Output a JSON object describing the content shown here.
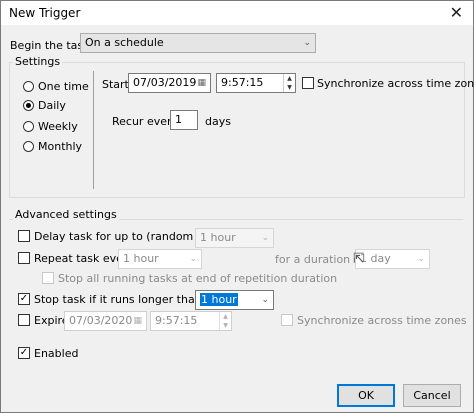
{
  "window": {
    "title": "New Trigger",
    "close_glyph": "✕"
  },
  "begin_task": {
    "label": "Begin the task:",
    "value": "On a schedule"
  },
  "settings": {
    "title": "Settings",
    "options": [
      "One time",
      "Daily",
      "Weekly",
      "Monthly"
    ],
    "selected": "Daily",
    "start_label": "Start:",
    "start_date": "07/03/2019",
    "start_time": "9:57:15",
    "sync_label": "Synchronize across time zones",
    "recur_label": "Recur every:",
    "recur_value": "1",
    "recur_unit": "days"
  },
  "advanced": {
    "title": "Advanced settings",
    "delay_label": "Delay task for up to (random delay):",
    "delay_value": "1 hour",
    "repeat_label": "Repeat task every:",
    "repeat_value": "1 hour",
    "duration_label": "for a duration of:",
    "duration_value": "1 day",
    "stop_all_label": "Stop all running tasks at end of repetition duration",
    "stop_if_label": "Stop task if it runs longer than:",
    "stop_if_value": "1 hour",
    "expire_label": "Expire:",
    "expire_date": "07/03/2020",
    "expire_time": "9:57:15",
    "expire_sync_label": "Synchronize across time zones",
    "enabled_label": "Enabled"
  },
  "buttons": {
    "ok": "OK",
    "cancel": "Cancel"
  },
  "icons": {
    "check": "✓",
    "chevron": "⌄",
    "calendar": "▦",
    "up": "▲",
    "down": "▼",
    "pointer": "⇱"
  }
}
